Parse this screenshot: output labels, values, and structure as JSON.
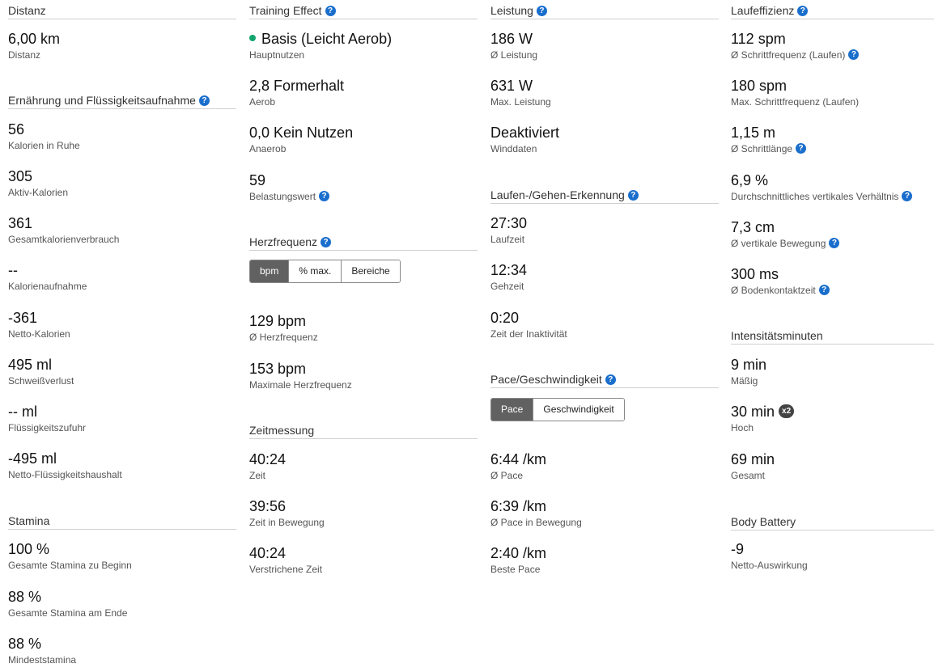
{
  "help_glyph": "?",
  "col1": {
    "distanz": {
      "title": "Distanz",
      "value": "6,00 km",
      "label": "Distanz"
    },
    "ernaehrung": {
      "title": "Ernährung und Flüssigkeitsaufnahme",
      "items": [
        {
          "value": "56",
          "label": "Kalorien in Ruhe"
        },
        {
          "value": "305",
          "label": "Aktiv-Kalorien"
        },
        {
          "value": "361",
          "label": "Gesamtkalorienverbrauch"
        },
        {
          "value": "--",
          "label": "Kalorienaufnahme"
        },
        {
          "value": "-361",
          "label": "Netto-Kalorien"
        },
        {
          "value": "495 ml",
          "label": "Schweißverlust"
        },
        {
          "value": "-- ml",
          "label": "Flüssigkeitszufuhr"
        },
        {
          "value": "-495 ml",
          "label": "Netto-Flüssigkeitshaushalt"
        }
      ]
    },
    "stamina": {
      "title": "Stamina",
      "items": [
        {
          "value": "100 %",
          "label": "Gesamte Stamina zu Beginn"
        },
        {
          "value": "88 %",
          "label": "Gesamte Stamina am Ende"
        },
        {
          "value": "88 %",
          "label": "Mindeststamina"
        }
      ]
    }
  },
  "col2": {
    "training_effect": {
      "title": "Training Effect",
      "dot_color": "#12a56d",
      "items": [
        {
          "value": "Basis (Leicht Aerob)",
          "label": "Hauptnutzen"
        },
        {
          "value": "2,8 Formerhalt",
          "label": "Aerob"
        },
        {
          "value": "0,0 Kein Nutzen",
          "label": "Anaerob"
        },
        {
          "value": "59",
          "label": "Belastungswert"
        }
      ]
    },
    "herzfrequenz": {
      "title": "Herzfrequenz",
      "tabs": [
        "bpm",
        "% max.",
        "Bereiche"
      ],
      "active_tab": "bpm",
      "items": [
        {
          "value": "129 bpm",
          "label": "Ø Herzfrequenz"
        },
        {
          "value": "153 bpm",
          "label": "Maximale Herzfrequenz"
        }
      ]
    },
    "zeitmessung": {
      "title": "Zeitmessung",
      "items": [
        {
          "value": "40:24",
          "label": "Zeit"
        },
        {
          "value": "39:56",
          "label": "Zeit in Bewegung"
        },
        {
          "value": "40:24",
          "label": "Verstrichene Zeit"
        }
      ]
    }
  },
  "col3": {
    "leistung": {
      "title": "Leistung",
      "items": [
        {
          "value": "186 W",
          "label": "Ø Leistung"
        },
        {
          "value": "631 W",
          "label": "Max. Leistung"
        },
        {
          "value": "Deaktiviert",
          "label": "Winddaten"
        }
      ]
    },
    "laufen_gehen": {
      "title": "Laufen-/Gehen-Erkennung",
      "items": [
        {
          "value": "27:30",
          "label": "Laufzeit"
        },
        {
          "value": "12:34",
          "label": "Gehzeit"
        },
        {
          "value": "0:20",
          "label": "Zeit der Inaktivität"
        }
      ]
    },
    "pace": {
      "title": "Pace/Geschwindigkeit",
      "tabs": [
        "Pace",
        "Geschwindigkeit"
      ],
      "active_tab": "Pace",
      "items": [
        {
          "value": "6:44 /km",
          "label": "Ø Pace"
        },
        {
          "value": "6:39 /km",
          "label": "Ø Pace in Bewegung"
        },
        {
          "value": "2:40 /km",
          "label": "Beste Pace"
        }
      ]
    }
  },
  "col4": {
    "laufeffizienz": {
      "title": "Laufeffizienz",
      "items": [
        {
          "value": "112 spm",
          "label": "Ø Schrittfrequenz (Laufen)"
        },
        {
          "value": "180 spm",
          "label": "Max. Schrittfrequenz (Laufen)"
        },
        {
          "value": "1,15 m",
          "label": "Ø Schrittlänge"
        },
        {
          "value": "6,9 %",
          "label": "Durchschnittliches vertikales Verhältnis"
        },
        {
          "value": "7,3 cm",
          "label": "Ø vertikale Bewegung"
        },
        {
          "value": "300 ms",
          "label": "Ø Bodenkontaktzeit"
        }
      ]
    },
    "intensitaet": {
      "title": "Intensitätsminuten",
      "badge": "x2",
      "items": [
        {
          "value": "9 min",
          "label": "Mäßig"
        },
        {
          "value": "30 min",
          "label": "Hoch"
        },
        {
          "value": "69 min",
          "label": "Gesamt"
        }
      ]
    },
    "body_battery": {
      "title": "Body Battery",
      "items": [
        {
          "value": "-9",
          "label": "Netto-Auswirkung"
        }
      ]
    }
  }
}
